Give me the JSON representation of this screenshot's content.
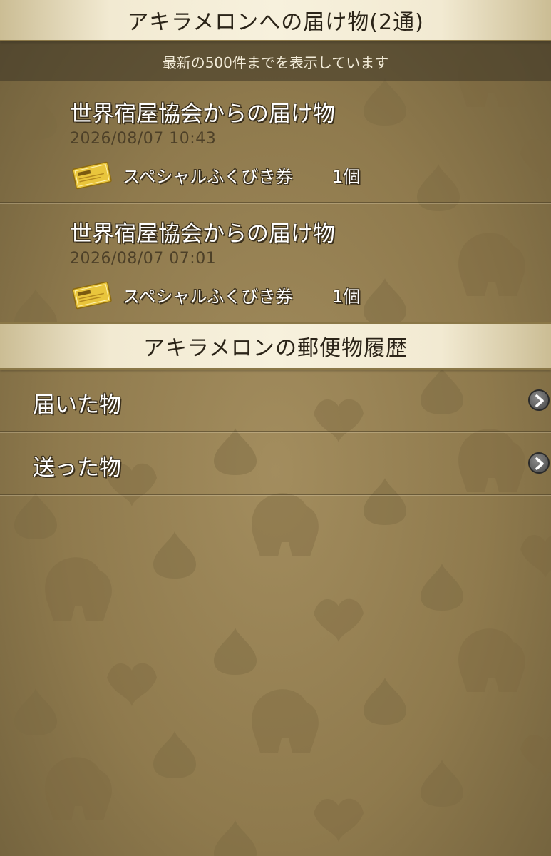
{
  "header": {
    "title": "アキラメロンへの届け物(2通)",
    "notice": "最新の500件までを表示しています"
  },
  "mail": [
    {
      "sender": "世界宿屋協会からの届け物",
      "date": "2026/08/07  10:43",
      "item_name": "スペシャルふくびき券",
      "item_count": "1個",
      "icon": "ticket-icon"
    },
    {
      "sender": "世界宿屋協会からの届け物",
      "date": "2026/08/07  07:01",
      "item_name": "スペシャルふくびき券",
      "item_count": "1個",
      "icon": "ticket-icon"
    }
  ],
  "history": {
    "title": "アキラメロンの郵便物履歴",
    "items": [
      {
        "label": "届いた物",
        "icon": "chevron-right-icon"
      },
      {
        "label": "送った物",
        "icon": "chevron-right-icon"
      }
    ]
  },
  "colors": {
    "banner": "#f4eddb",
    "background": "#8f7a4d",
    "text_outline": "#3a2f1c",
    "ticket": "#e8c33a"
  }
}
